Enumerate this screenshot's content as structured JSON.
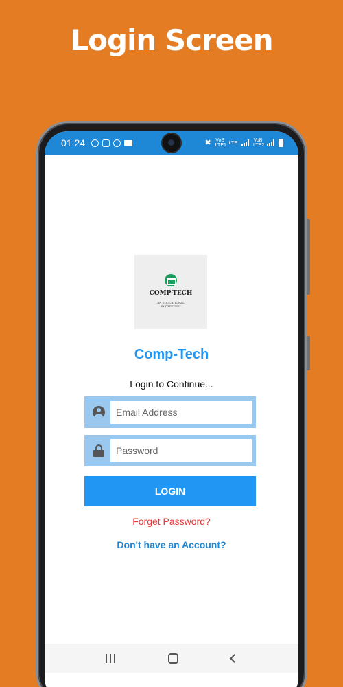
{
  "banner": {
    "title": "Login Screen"
  },
  "status_bar": {
    "time": "01:24",
    "net1": "VoB LTE1",
    "net2": "LTE",
    "net3": "VoB LTE2"
  },
  "logo": {
    "name": "COMP-TECH",
    "tagline": "AN EDUCATIONAL INSTITUTION"
  },
  "app": {
    "name": "Comp-Tech",
    "subtitle": "Login to Continue..."
  },
  "form": {
    "email_placeholder": "Email Address",
    "password_placeholder": "Password",
    "login_label": "LOGIN",
    "forget_label": "Forget Password?",
    "signup_label": "Don't have an Account?"
  },
  "colors": {
    "background": "#E37C22",
    "accent": "#2196F3",
    "field_bg": "#9BC8EE",
    "forget": "#E53935"
  },
  "icons": [
    "whatsapp-icon",
    "instagram-icon",
    "phone-icon",
    "message-icon",
    "mute-icon",
    "signal-icon",
    "battery-icon",
    "user-icon",
    "lock-icon",
    "recent-apps-icon",
    "home-icon",
    "back-icon"
  ]
}
